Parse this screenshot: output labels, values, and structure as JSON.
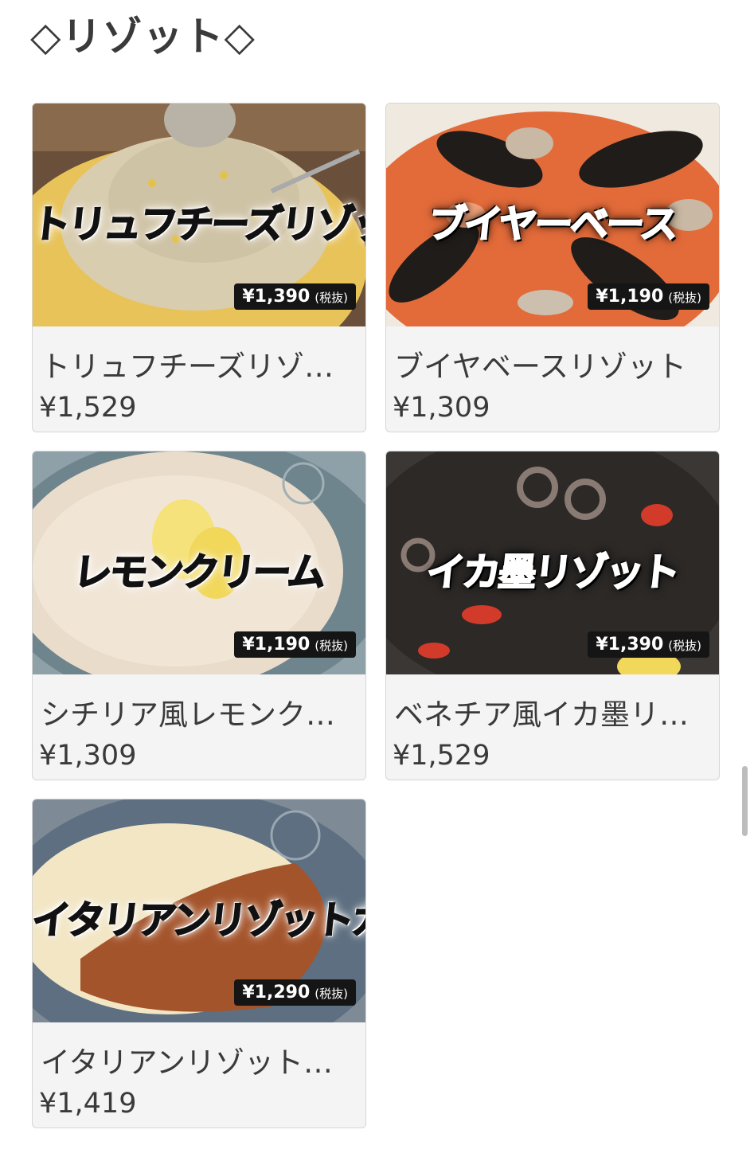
{
  "section": {
    "title": "◇リゾット◇"
  },
  "items": [
    {
      "name": "トリュフチーズリゾット",
      "price": "¥1,529",
      "overlay_title": "トリュフチーズリゾット",
      "tag_price": "¥1,390",
      "tag_note": "(税抜)"
    },
    {
      "name": "ブイヤベースリゾット",
      "price": "¥1,309",
      "overlay_title": "ブイヤーベース",
      "tag_price": "¥1,190",
      "tag_note": "(税抜)"
    },
    {
      "name": "シチリア風レモンクリームリゾット",
      "price": "¥1,309",
      "overlay_title": "レモンクリーム",
      "tag_price": "¥1,190",
      "tag_note": "(税抜)"
    },
    {
      "name": "ベネチア風イカ墨リゾット",
      "price": "¥1,529",
      "overlay_title": "イカ墨リゾット",
      "tag_price": "¥1,390",
      "tag_note": "(税抜)"
    },
    {
      "name": "イタリアンリゾットカレー",
      "price": "¥1,419",
      "overlay_title": "イタリアンリゾットカレー",
      "tag_price": "¥1,290",
      "tag_note": "(税抜)"
    }
  ],
  "colors": {
    "card_bg": "#f4f4f4",
    "text": "#3a3a3a",
    "tag_bg": "#151515"
  }
}
